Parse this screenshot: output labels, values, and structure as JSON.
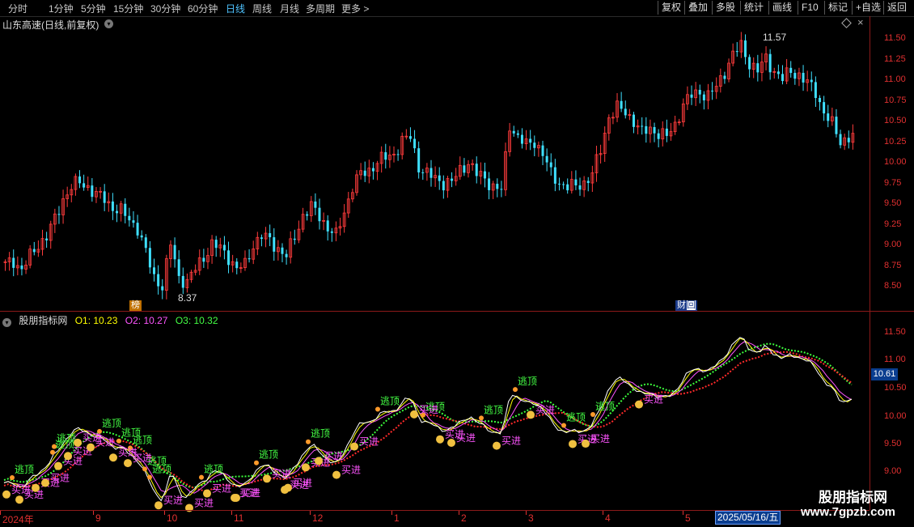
{
  "toolbar": {
    "timeframes": [
      "分时",
      "1分钟",
      "5分钟",
      "15分钟",
      "30分钟",
      "60分钟",
      "日线",
      "周线",
      "月线",
      "多周期",
      "更多 >"
    ],
    "active_timeframe": "日线",
    "right_buttons": [
      "复权",
      "叠加",
      "多股",
      "统计",
      "画线",
      "F10",
      "标记",
      "+自选",
      "返回"
    ]
  },
  "main_chart": {
    "title": "山东高速(日线,前复权)",
    "y_axis_labels": [
      "11.50",
      "11.25",
      "11.00",
      "10.75",
      "10.50",
      "10.25",
      "10.00",
      "9.75",
      "9.50",
      "9.25",
      "9.00",
      "8.75",
      "8.50"
    ],
    "high_annotation": "11.57",
    "low_annotation": "8.37",
    "badge_rank": "榜",
    "badge_finance": "财",
    "badge_finance_suffix": "回"
  },
  "indicator": {
    "name": "股朋指标网",
    "o1": "O1: 10.23",
    "o2": "O2: 10.27",
    "o3": "O3: 10.32",
    "y_axis_labels": [
      "11.50",
      "11.00",
      "10.50",
      "10.00",
      "9.50",
      "9.00"
    ],
    "current_value": "10.61",
    "signal_escape": "逃顶",
    "signal_buy": "买进",
    "colors": {
      "o1": "#ffff00",
      "o2": "#ff55ff",
      "o3": "#44ff44"
    }
  },
  "date_axis": {
    "year_label": "2024年",
    "months": [
      "9",
      "10",
      "11",
      "12",
      "1",
      "2",
      "3",
      "4",
      "5"
    ],
    "cursor_date": "2025/05/16/五"
  },
  "watermark": {
    "line1": "股朋指标网",
    "line2": "www.7gpzb.com"
  },
  "chart_data": {
    "type": "candlestick",
    "price_range": [
      8.37,
      11.57
    ],
    "y_ticks": [
      8.5,
      8.75,
      9.0,
      9.25,
      9.5,
      9.75,
      10.0,
      10.25,
      10.5,
      10.75,
      11.0,
      11.25,
      11.5
    ],
    "close_series_approx": [
      8.75,
      8.8,
      8.7,
      8.85,
      9.0,
      9.1,
      9.3,
      9.55,
      9.7,
      9.75,
      9.7,
      9.6,
      9.55,
      9.45,
      9.4,
      9.3,
      9.2,
      8.9,
      8.6,
      8.5,
      9.0,
      8.6,
      8.55,
      8.7,
      8.85,
      9.0,
      8.95,
      8.85,
      8.7,
      8.75,
      9.0,
      9.1,
      9.05,
      8.95,
      8.85,
      9.1,
      9.35,
      9.45,
      9.35,
      9.2,
      9.1,
      9.4,
      9.7,
      9.85,
      9.9,
      10.0,
      10.05,
      10.1,
      10.25,
      10.3,
      9.95,
      9.85,
      9.8,
      9.75,
      9.75,
      9.9,
      10.0,
      9.85,
      9.8,
      9.7,
      9.65,
      10.45,
      10.3,
      10.2,
      10.25,
      10.1,
      9.85,
      9.75,
      9.7,
      9.7,
      9.75,
      9.85,
      10.15,
      10.55,
      10.65,
      10.6,
      10.5,
      10.35,
      10.4,
      10.35,
      10.3,
      10.45,
      10.7,
      10.8,
      10.85,
      10.8,
      10.9,
      11.1,
      11.3,
      11.4,
      11.2,
      11.1,
      11.25,
      11.1,
      11.0,
      11.1,
      11.05,
      10.95,
      10.85,
      10.6,
      10.45,
      10.25,
      10.3
    ]
  }
}
